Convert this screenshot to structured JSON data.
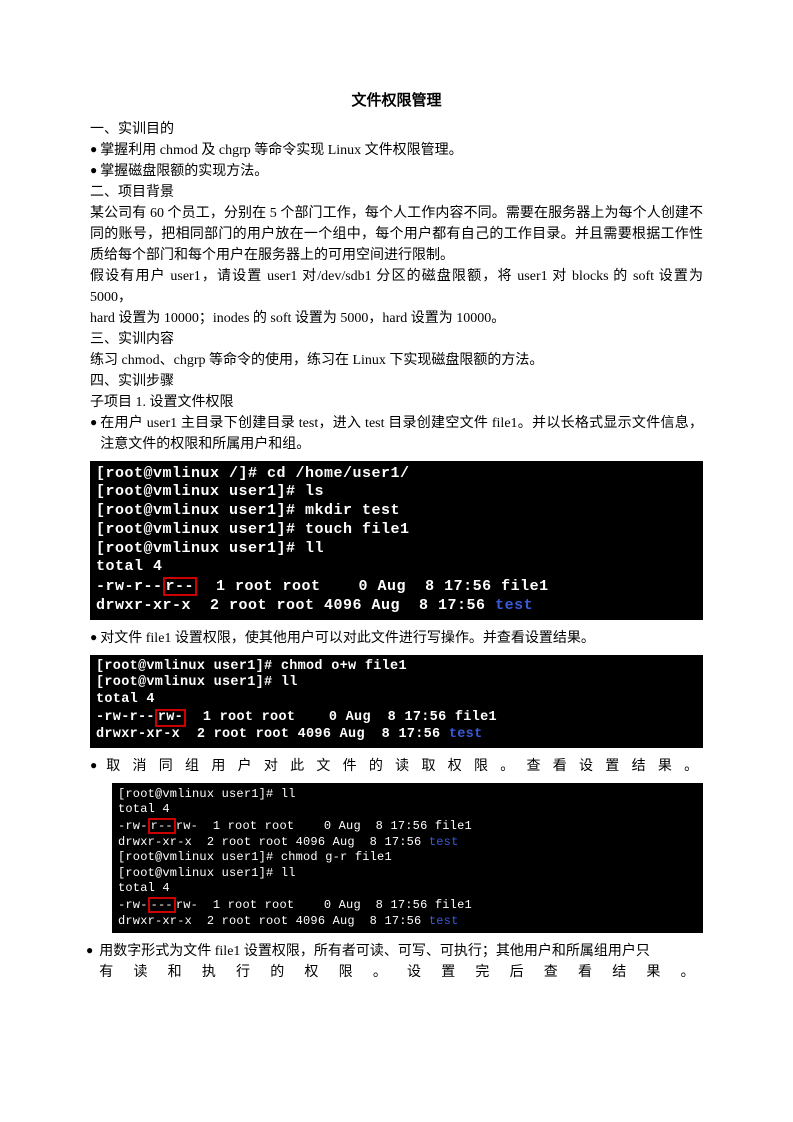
{
  "title": "文件权限管理",
  "s1": "一、实训目的",
  "b1": "掌握利用 chmod  及  chgrp 等命令实现 Linux 文件权限管理。",
  "b2": "掌握磁盘限额的实现方法。",
  "s2": "二、项目背景",
  "p1": "某公司有 60 个员工，分别在 5 个部门工作，每个人工作内容不同。需要在服务器上为每个人创建不同的账号，把相同部门的用户放在一个组中，每个用户都有自己的工作目录。并且需要根据工作性质给每个部门和每个用户在服务器上的可用空间进行限制。",
  "p2": "假设有用户 user1，请设置 user1  对/dev/sdb1 分区的磁盘限额，将  user1  对 blocks 的  soft 设置为 5000，",
  "p3": "hard 设置为 10000；inodes 的 soft 设置为 5000，hard  设置为 10000。",
  "s3": "三、实训内容",
  "p4": "练习 chmod、chgrp 等命令的使用，练习在 Linux 下实现磁盘限额的方法。",
  "s4": "四、实训步骤",
  "p5": "子项目 1.  设置文件权限",
  "b3": "在用户 user1 主目录下创建目录 test，进入 test 目录创建空文件 file1。并以长格式显示文件信息，注意文件的权限和所属用户和组。",
  "term1a": "[root@vmlinux /]# cd /home/user1/",
  "term1b": "[root@vmlinux user1]# ls",
  "term1c": "[root@vmlinux user1]# mkdir test",
  "term1d": "[root@vmlinux user1]# touch file1",
  "term1e": "[root@vmlinux user1]# ll",
  "term1f": "total 4",
  "term1g1": "-rw-r--",
  "term1g_hl": "r--",
  "term1g2": "  1 root root    0 Aug  8 17:56 file1",
  "term1h": "drwxr-xr-x  2 root root 4096 Aug  8 17:56 ",
  "term1h_blue": "test",
  "b4": "对文件 file1  设置权限，使其他用户可以对此文件进行写操作。并查看设置结果。",
  "term2a": "[root@vmlinux user1]# chmod o+w file1",
  "term2b": "[root@vmlinux user1]# ll",
  "term2c": "total 4",
  "term2d1": "-rw-r--",
  "term2d_hl": "rw-",
  "term2d2": "  1 root root    0 Aug  8 17:56 file1",
  "term2e": "drwxr-xr-x  2 root root 4096 Aug  8 17:56 ",
  "term2e_blue": "test",
  "b5": "取消同组用户对此文件的读取权限。查看设置结果。",
  "term3a": "[root@vmlinux user1]# ll",
  "term3b": "total 4",
  "term3c1": "-rw-",
  "term3c_hl": "r--",
  "term3c2": "rw-  1 root root    0 Aug  8 17:56 file1",
  "term3d": "drwxr-xr-x  2 root root 4096 Aug  8 17:56 ",
  "term3d_blue": "test",
  "term3e": "[root@vmlinux user1]# chmod g-r file1",
  "term3f": "[root@vmlinux user1]# ll",
  "term3g": "total 4",
  "term3h1": "-rw-",
  "term3h_hl": "---",
  "term3h2": "rw-  1 root root    0 Aug  8 17:56 file1",
  "term3i": "drwxr-xr-x  2 root root 4096 Aug  8 17:56 ",
  "term3i_blue": "test",
  "b6a": "用数字形式为文件 file1 设置权限，所有者可读、可写、可执行；其他用户和所属组用户只",
  "b6b": "有读和执行的权限。设置完后查看结果。"
}
